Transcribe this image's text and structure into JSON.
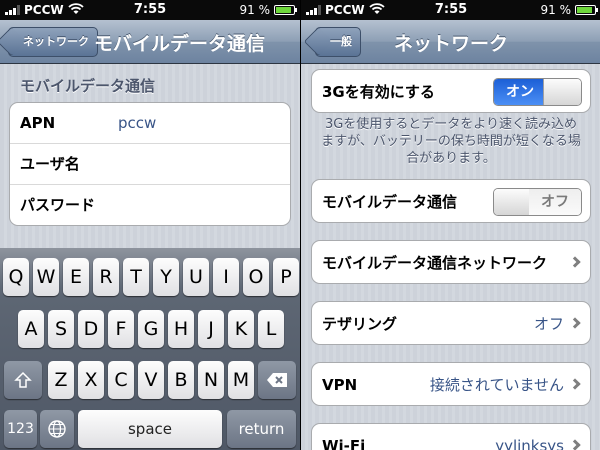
{
  "status_bar": {
    "carrier": "PCCW",
    "time": "7:55",
    "battery": "91 %",
    "battery_level": 0.91
  },
  "left_screen": {
    "back_button": "ネットワーク",
    "title": "モバイルデータ通信",
    "section_header": "モバイルデータ通信",
    "fields": [
      {
        "label": "APN",
        "value": "pccw"
      },
      {
        "label": "ユーザ名",
        "value": ""
      },
      {
        "label": "パスワード",
        "value": ""
      }
    ],
    "keyboard": {
      "row1": [
        "Q",
        "W",
        "E",
        "R",
        "T",
        "Y",
        "U",
        "I",
        "O",
        "P"
      ],
      "row2": [
        "A",
        "S",
        "D",
        "F",
        "G",
        "H",
        "J",
        "K",
        "L"
      ],
      "row3": [
        "Z",
        "X",
        "C",
        "V",
        "B",
        "N",
        "M"
      ],
      "numbers_key": "123",
      "space_key": "space",
      "return_key": "return"
    }
  },
  "right_screen": {
    "back_button": "一般",
    "title": "ネットワーク",
    "enable_3g": {
      "label": "3Gを有効にする",
      "toggle_label": "オン",
      "state": "on"
    },
    "footer_note": "3Gを使用するとデータをより速く読み込めますが、バッテリーの保ち時間が短くなる場合があります。",
    "mobile_data": {
      "label": "モバイルデータ通信",
      "toggle_label": "オフ",
      "state": "off"
    },
    "mobile_data_network": {
      "label": "モバイルデータ通信ネットワーク"
    },
    "tethering": {
      "label": "テザリング",
      "value": "オフ"
    },
    "vpn": {
      "label": "VPN",
      "value": "接続されていません"
    },
    "wifi": {
      "label": "Wi-Fi",
      "value": "yylinksys"
    }
  }
}
